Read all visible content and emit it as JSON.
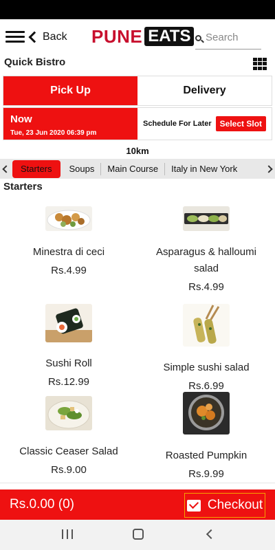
{
  "header": {
    "back_label": "Back",
    "logo_word1": "PUNE",
    "logo_word2": "EATS",
    "search_placeholder": "Search"
  },
  "restaurant": {
    "name": "Quick Bistro"
  },
  "order_mode": {
    "pickup_label": "Pick Up",
    "delivery_label": "Delivery",
    "selected": "Pick Up"
  },
  "schedule": {
    "now_label": "Now",
    "now_datetime": "Tue, 23 Jun 2020 06:39 pm",
    "later_label": "Schedule For Later",
    "select_slot_label": "Select Slot"
  },
  "distance": "10km",
  "categories": {
    "items": [
      "Starters",
      "Soups",
      "Main Course",
      "Italy in New York"
    ],
    "selected": "Starters"
  },
  "section_title": "Starters",
  "products": [
    {
      "name": "Minestra di ceci",
      "price": "Rs.4.99",
      "image": "fried-squid-dish"
    },
    {
      "name": "Asparagus & halloumi salad",
      "price": "Rs.4.99",
      "image": "asparagus-platter"
    },
    {
      "name": "Sushi Roll",
      "price": "Rs.12.99",
      "image": "sushi-roll"
    },
    {
      "name": "Simple sushi salad",
      "price": "Rs.6.99",
      "image": "sushi-salad-chopsticks"
    },
    {
      "name": "Classic Ceaser Salad",
      "price": "Rs.9.00",
      "image": "caesar-salad"
    },
    {
      "name": "Roasted Pumpkin",
      "price": "Rs.9.99",
      "image": "roasted-pumpkin-pan"
    }
  ],
  "cart": {
    "total": "Rs.0.00 (0)",
    "checkout_label": "Checkout"
  },
  "colors": {
    "accent": "#ee1111",
    "logo_red": "#c8102e",
    "checkout_border": "#f6a300"
  }
}
